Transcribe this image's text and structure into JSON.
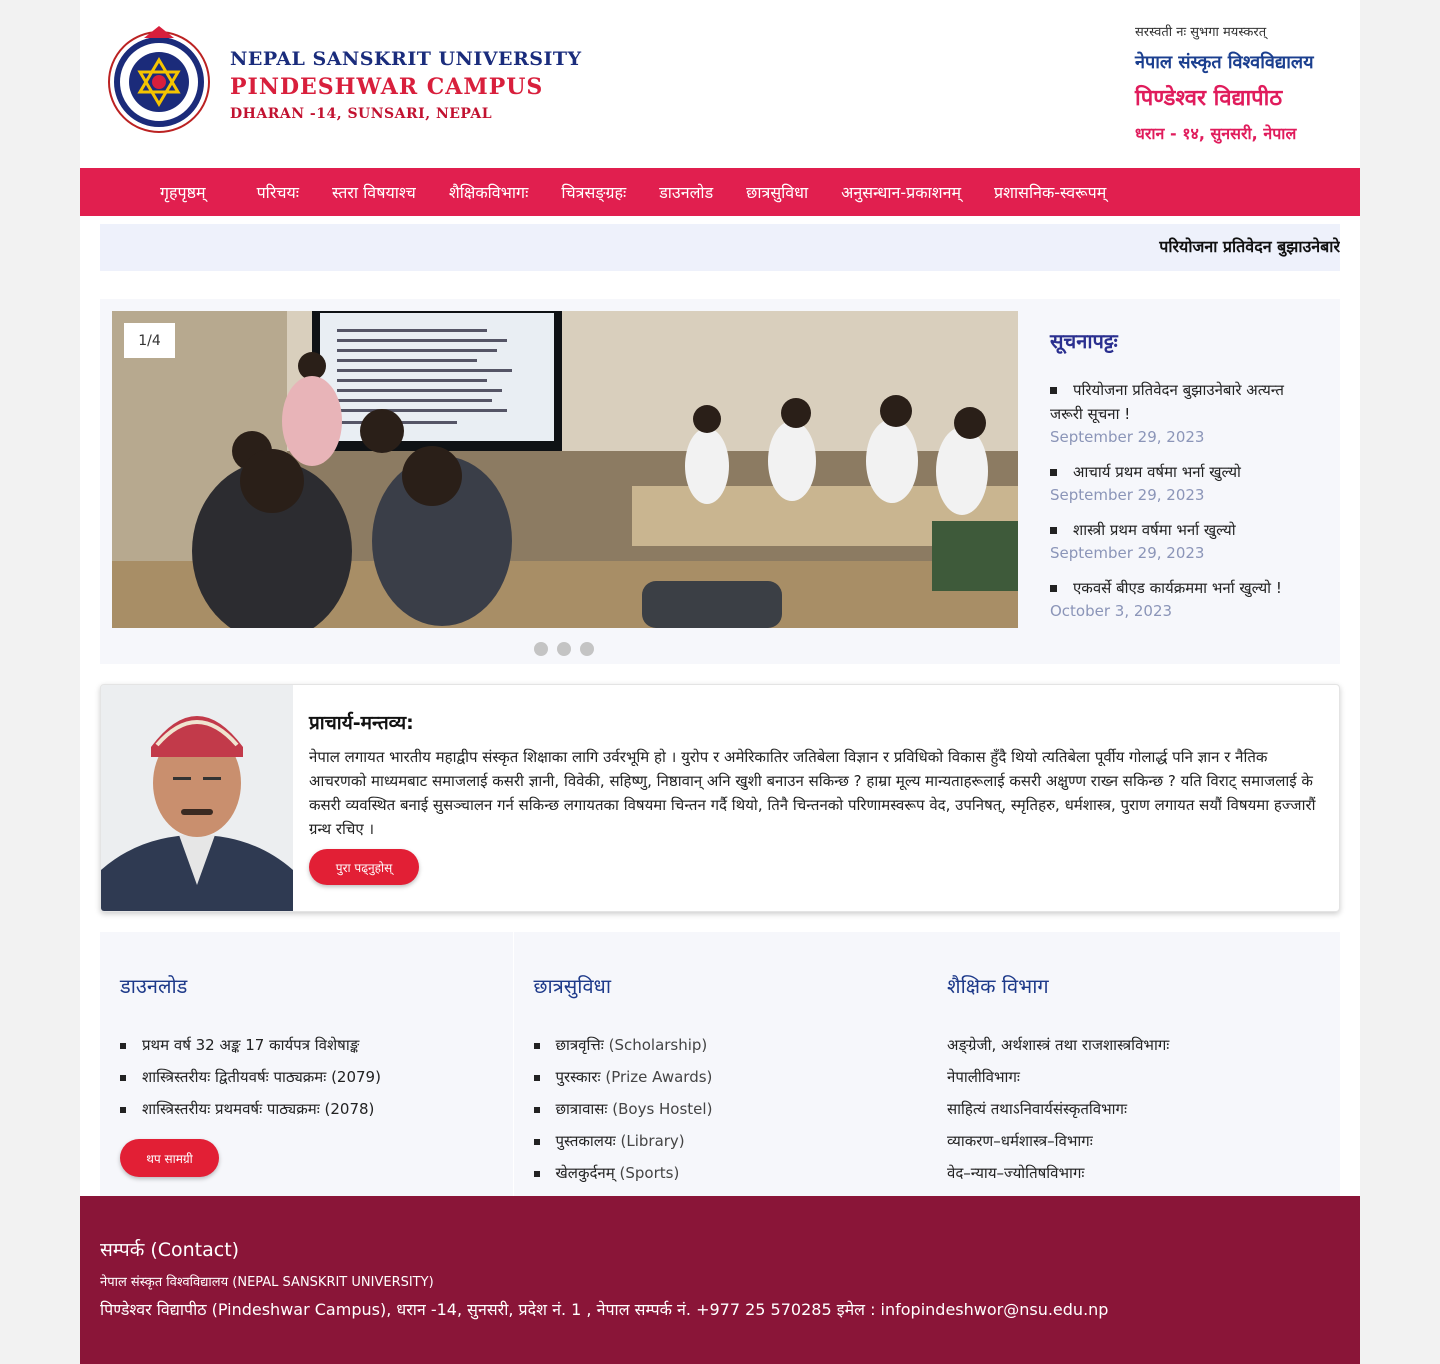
{
  "header": {
    "en_university": "NEPAL SANSKRIT UNIVERSITY",
    "en_campus": "PINDESHWAR CAMPUS",
    "en_address": "DHARAN -14, SUNSARI, NEPAL",
    "np_motto": "सरस्वती नः सुभगा मयस्करत्",
    "np_university": "नेपाल संस्कृत विश्वविद्यालय",
    "np_campus": "पिण्डेश्वर विद्यापीठ",
    "np_address": "धरान - १४, सुनसरी, नेपाल"
  },
  "nav": [
    "गृहपृष्ठम्",
    "परिचयः",
    "स्तरा विषयाश्च",
    "शैक्षिकविभागः",
    "चित्रसङ्ग्रहः",
    "डाउनलोड",
    "छात्रसुविधा",
    "अनुसन्धान-प्रकाशनम्",
    "प्रशासनिक-स्वरूपम्"
  ],
  "ticker": {
    "text": "परियोजना प्रतिवेदन बुझाउनेबारे"
  },
  "slider": {
    "counter": "1/4",
    "slide_count": 3
  },
  "notices": {
    "title": "सूचनापट्टः",
    "items": [
      {
        "text": "परियोजना प्रतिवेदन बुझाउनेबारे अत्यन्त जरूरी सूचना !",
        "date": "September 29, 2023"
      },
      {
        "text": "आचार्य प्रथम वर्षमा भर्ना खुल्यो",
        "date": "September 29, 2023"
      },
      {
        "text": "शास्त्री प्रथम वर्षमा भर्ना खुल्यो",
        "date": "September 29, 2023"
      },
      {
        "text": "एकवर्से बीएड कार्यक्रममा भर्ना खुल्यो !",
        "date": "October 3, 2023"
      }
    ]
  },
  "principal": {
    "title": "प्राचार्य-मन्तव्य:",
    "text": "नेपाल लगायत भारतीय महाद्वीप संस्कृत शिक्षाका लागि उर्वरभूमि हो । युरोप र अमेरिकातिर जतिबेला विज्ञान र प्रविधिको विकास हुँदै थियो त्यतिबेला पूर्वीय गोलार्द्ध पनि ज्ञान र नैतिक आचरणको माध्यमबाट समाजलाई कसरी ज्ञानी, विवेकी, सहिष्णु, निष्ठावान् अनि खुशी बनाउन सकिन्छ ? हाम्रा मूल्य मान्यताहरूलाई कसरी अक्षुण्ण राख्न सकिन्छ ? यति विराट् समाजलाई के कसरी व्यवस्थित बनाई सुसञ्चालन गर्न सकिन्छ लगायतका विषयमा चिन्तन गर्दै थियो, तिनै चिन्तनको परिणामस्वरूप वेद, उपनिषत्, स्मृतिहरु, धर्मशास्त्र, पुराण लगायत सयौं विषयमा हज्जारौं ग्रन्थ रचिए ।",
    "button": "पुरा पढ्नुहोस्"
  },
  "downloads": {
    "title": "डाउनलोड",
    "items": [
      "प्रथम वर्ष 32 अङ्क 17 कार्यपत्र विशेषाङ्क",
      "शास्त्रिस्तरीयः द्वितीयवर्षः पाठ्यक्रमः (2079)",
      "शास्त्रिस्तरीयः प्रथमवर्षः पाठ्यक्रमः (2078)"
    ],
    "button": "थप सामग्री"
  },
  "facilities": {
    "title": "छात्रसुविधा",
    "items": [
      {
        "np": "छात्रवृत्तिः",
        "en": "(Scholarship)"
      },
      {
        "np": "पुरस्कारः",
        "en": "(Prize Awards)"
      },
      {
        "np": "छात्रावासः",
        "en": "(Boys Hostel)"
      },
      {
        "np": "पुस्तकालयः",
        "en": "(Library)"
      },
      {
        "np": "खेलकुर्दनम्",
        "en": "(Sports)"
      }
    ]
  },
  "departments": {
    "title": "शैक्षिक विभाग",
    "items": [
      "अङ्ग्रेजी, अर्थशास्त्रं तथा राजशास्त्रविभागः",
      "नेपालीविभागः",
      "साहित्यं तथाऽनिवार्यसंस्कृतविभागः",
      "व्याकरण–धर्मशास्त्र–विभागः",
      "वेद–न्याय–ज्योतिषविभागः"
    ]
  },
  "footer": {
    "title": "सम्पर्क (Contact)",
    "university": "नेपाल संस्कृत विश्वविद्यालय (NEPAL SANSKRIT UNIVERSITY)",
    "address": "पिण्डेश्वर विद्यापीठ (Pindeshwar Campus), धरान -14, सुनसरी, प्रदेश नं. 1 , नेपाल सम्पर्क नं. +977 25 570285 इमेल : infopindeshwor@nsu.edu.np"
  },
  "colors": {
    "nav": "#e11f4f",
    "footer": "#8a1538",
    "button": "#e21f35",
    "heading_blue": "#1e3a8a"
  }
}
